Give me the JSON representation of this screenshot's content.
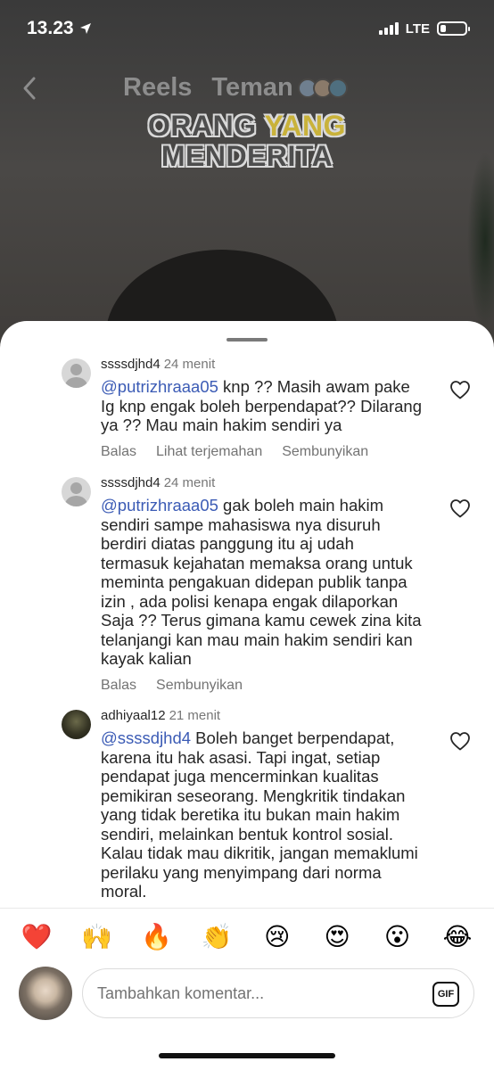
{
  "status": {
    "time": "13.23",
    "network": "LTE"
  },
  "reel": {
    "tabs": [
      "Reels",
      "Teman"
    ],
    "caption_line1_a": "ORANG ",
    "caption_line1_b": "YANG",
    "caption_line2": "MENDERITA"
  },
  "comments": [
    {
      "username": "ssssdjhd4",
      "time": "24 menit",
      "mention": "@putrizhraaa05",
      "text": " knp ?? Masih awam pake Ig knp engak boleh berpendapat?? Dilarang ya ?? Mau main hakim sendiri ya",
      "actions": [
        "Balas",
        "Lihat terjemahan",
        "Sembunyikan"
      ]
    },
    {
      "username": "ssssdjhd4",
      "time": "24 menit",
      "mention": "@putrizhraaa05",
      "text": " gak boleh main hakim sendiri sampe mahasiswa nya disuruh berdiri diatas panggung itu aj udah termasuk kejahatan memaksa orang untuk meminta pengakuan didepan publik tanpa izin , ada polisi kenapa engak dilaporkan Saja ?? Terus gimana kamu cewek zina kita telanjangi kan mau main hakim sendiri kan kayak kalian",
      "actions": [
        "Balas",
        "Sembunyikan"
      ]
    },
    {
      "username": "adhiyaal12",
      "time": "21 menit",
      "mention": "@ssssdjhd4",
      "text": " Boleh banget berpendapat, karena itu hak asasi. Tapi ingat, setiap pendapat juga mencerminkan kualitas pemikiran seseorang. Mengkritik tindakan yang tidak beretika itu bukan main hakim sendiri, melainkan bentuk kontrol sosial. Kalau tidak mau dikritik, jangan memaklumi perilaku yang menyimpang dari norma moral.",
      "actions": []
    }
  ],
  "reactions": [
    "❤️",
    "🙌",
    "🔥",
    "👏",
    "😢",
    "😍",
    "😮",
    "😂"
  ],
  "composer": {
    "placeholder": "Tambahkan komentar...",
    "gif_label": "GIF"
  },
  "colors": {
    "mention": "#3b5bb5",
    "meta_gray": "#737373"
  }
}
